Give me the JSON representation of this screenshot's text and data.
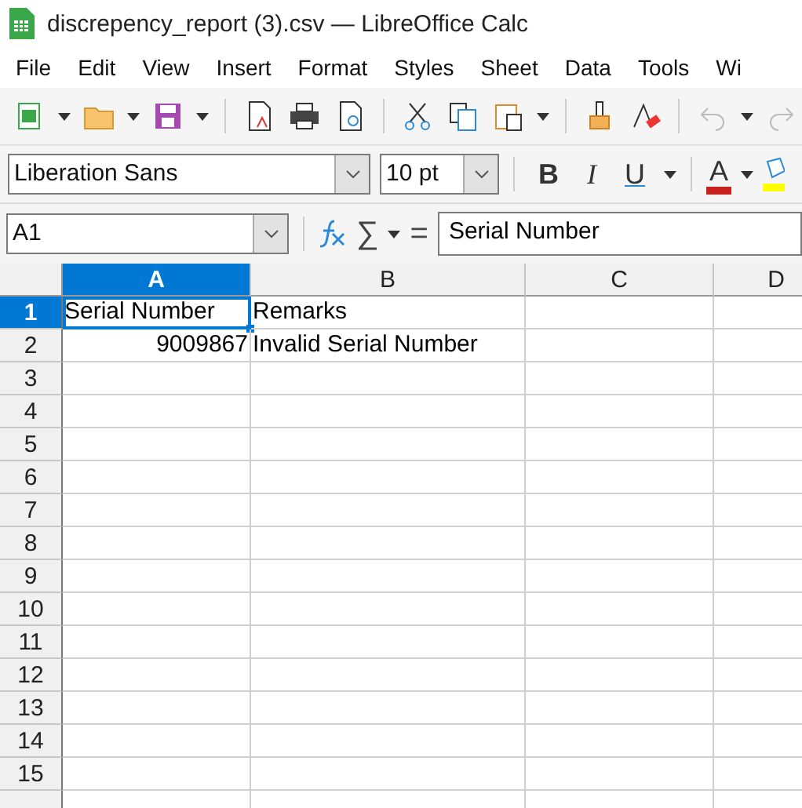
{
  "window": {
    "title": "discrepency_report (3).csv — LibreOffice Calc"
  },
  "menu": [
    "File",
    "Edit",
    "View",
    "Insert",
    "Format",
    "Styles",
    "Sheet",
    "Data",
    "Tools",
    "Wi"
  ],
  "format_bar": {
    "font_name": "Liberation Sans",
    "font_size": "10 pt",
    "bold_label": "B",
    "italic_label": "I",
    "underline_label": "U",
    "font_color_label": "A"
  },
  "formula_bar": {
    "name_box": "A1",
    "sigma": "∑",
    "equals": "=",
    "content": "Serial Number"
  },
  "sheet": {
    "columns": [
      {
        "label": "A",
        "selected": true
      },
      {
        "label": "B",
        "selected": false
      },
      {
        "label": "C",
        "selected": false
      },
      {
        "label": "D",
        "selected": false
      }
    ],
    "rows": [
      {
        "label": "1",
        "selected": true,
        "cells": [
          {
            "kind": "text",
            "value": "Serial Number",
            "active": true
          },
          {
            "kind": "text",
            "value": "Remarks",
            "active": false
          }
        ]
      },
      {
        "label": "2",
        "selected": false,
        "cells": [
          {
            "kind": "number",
            "value": "9009867",
            "active": false
          },
          {
            "kind": "text",
            "value": "Invalid Serial Number",
            "active": false
          }
        ]
      },
      {
        "label": "3",
        "selected": false,
        "cells": []
      },
      {
        "label": "4",
        "selected": false,
        "cells": []
      },
      {
        "label": "5",
        "selected": false,
        "cells": []
      },
      {
        "label": "6",
        "selected": false,
        "cells": []
      },
      {
        "label": "7",
        "selected": false,
        "cells": []
      },
      {
        "label": "8",
        "selected": false,
        "cells": []
      },
      {
        "label": "9",
        "selected": false,
        "cells": []
      },
      {
        "label": "10",
        "selected": false,
        "cells": []
      },
      {
        "label": "11",
        "selected": false,
        "cells": []
      },
      {
        "label": "12",
        "selected": false,
        "cells": []
      },
      {
        "label": "13",
        "selected": false,
        "cells": []
      },
      {
        "label": "14",
        "selected": false,
        "cells": []
      },
      {
        "label": "15",
        "selected": false,
        "cells": []
      }
    ]
  }
}
